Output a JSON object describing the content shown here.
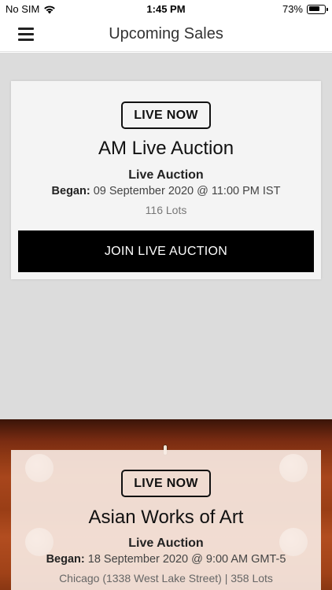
{
  "status_bar": {
    "carrier": "No SIM",
    "time": "1:45 PM",
    "battery_text": "73%",
    "battery_level": 0.73
  },
  "nav": {
    "title": "Upcoming Sales"
  },
  "sales": [
    {
      "badge": "LIVE NOW",
      "title": "AM Live Auction",
      "type": "Live Auction",
      "date_label": "Began:",
      "date_value": "09 September 2020 @ 11:00 PM IST",
      "lots": "116 Lots",
      "button": "JOIN LIVE AUCTION"
    },
    {
      "badge": "LIVE NOW",
      "title": "Asian Works of Art",
      "type": "Live Auction",
      "date_label": "Began:",
      "date_value": "18 September 2020 @ 9:00 AM GMT-5",
      "lots": "Chicago (1338 West Lake Street) | 358 Lots"
    }
  ],
  "colors": {
    "background": "#dcdcdc",
    "card": "#f4f4f4",
    "button": "#000000",
    "button_text": "#ffffff"
  },
  "icons": [
    "menu-icon",
    "wifi-icon",
    "battery-icon"
  ]
}
